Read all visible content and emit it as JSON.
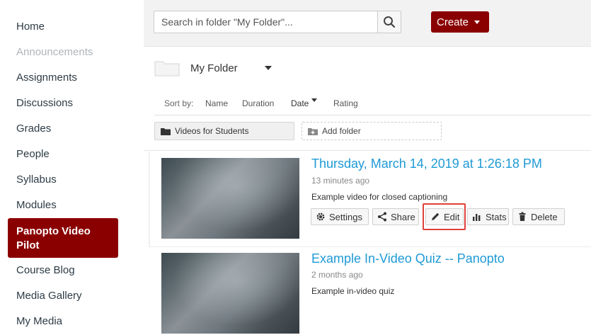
{
  "sidebar": {
    "items": [
      {
        "label": "Home"
      },
      {
        "label": "Announcements",
        "disabled": true
      },
      {
        "label": "Assignments"
      },
      {
        "label": "Discussions"
      },
      {
        "label": "Grades"
      },
      {
        "label": "People"
      },
      {
        "label": "Syllabus"
      },
      {
        "label": "Modules"
      },
      {
        "label": "Panopto Video Pilot",
        "active": true
      },
      {
        "label": "Course Blog"
      },
      {
        "label": "Media Gallery"
      },
      {
        "label": "My Media"
      }
    ]
  },
  "toolbar": {
    "search_placeholder": "Search in folder \"My Folder\"...",
    "search_icon": "search-icon",
    "create_label": "Create"
  },
  "folder": {
    "name": "My Folder"
  },
  "sort": {
    "label": "Sort by:",
    "options": [
      "Name",
      "Duration",
      "Date",
      "Rating"
    ],
    "active": "Date"
  },
  "subfolders": {
    "existing": "Videos for Students",
    "add_label": "Add folder"
  },
  "sessions": [
    {
      "title": "Thursday, March 14, 2019 at 1:26:18 PM",
      "time": "13 minutes ago",
      "description": "Example video for closed captioning",
      "actions": [
        "Settings",
        "Share",
        "Edit",
        "Stats",
        "Delete"
      ]
    },
    {
      "title": "Example In-Video Quiz -- Panopto",
      "time": "2 months ago",
      "description": "Example in-video quiz"
    }
  ],
  "colors": {
    "brand": "#8a0000",
    "link": "#1e9ad6",
    "highlight": "#e0403a"
  }
}
